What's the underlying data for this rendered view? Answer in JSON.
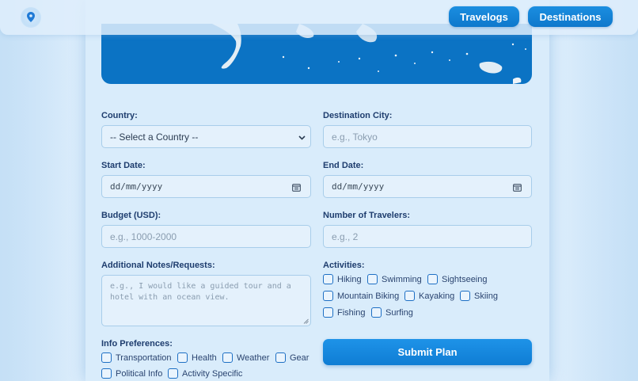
{
  "nav": {
    "travelogs": "Travelogs",
    "destinations": "Destinations"
  },
  "icons": {
    "logo": "map-pin-icon",
    "date": "calendar-icon",
    "select": "chevron-down-icon"
  },
  "colors": {
    "accent": "#0e78cc",
    "map_ocean": "#0b73c4",
    "label": "#1e3d6e"
  },
  "form": {
    "country": {
      "label": "Country:",
      "value": "-- Select a Country --"
    },
    "destination_city": {
      "label": "Destination City:",
      "placeholder": "e.g., Tokyo"
    },
    "start_date": {
      "label": "Start Date:",
      "value": "dd/mm/yyyy"
    },
    "end_date": {
      "label": "End Date:",
      "value": "dd/mm/yyyy"
    },
    "budget": {
      "label": "Budget (USD):",
      "placeholder": "e.g., 1000-2000"
    },
    "travelers": {
      "label": "Number of Travelers:",
      "placeholder": "e.g., 2"
    },
    "notes": {
      "label": "Additional Notes/Requests:",
      "placeholder": "e.g., I would like a guided tour and a hotel with an ocean view."
    },
    "activities": {
      "label": "Activities:",
      "options": [
        "Hiking",
        "Swimming",
        "Sightseeing",
        "Mountain Biking",
        "Kayaking",
        "Skiing",
        "Fishing",
        "Surfing"
      ]
    },
    "info_preferences": {
      "label": "Info Preferences:",
      "options": [
        "Transportation",
        "Health",
        "Weather",
        "Gear",
        "Political Info",
        "Activity Specific"
      ]
    },
    "submit": "Submit Plan"
  }
}
